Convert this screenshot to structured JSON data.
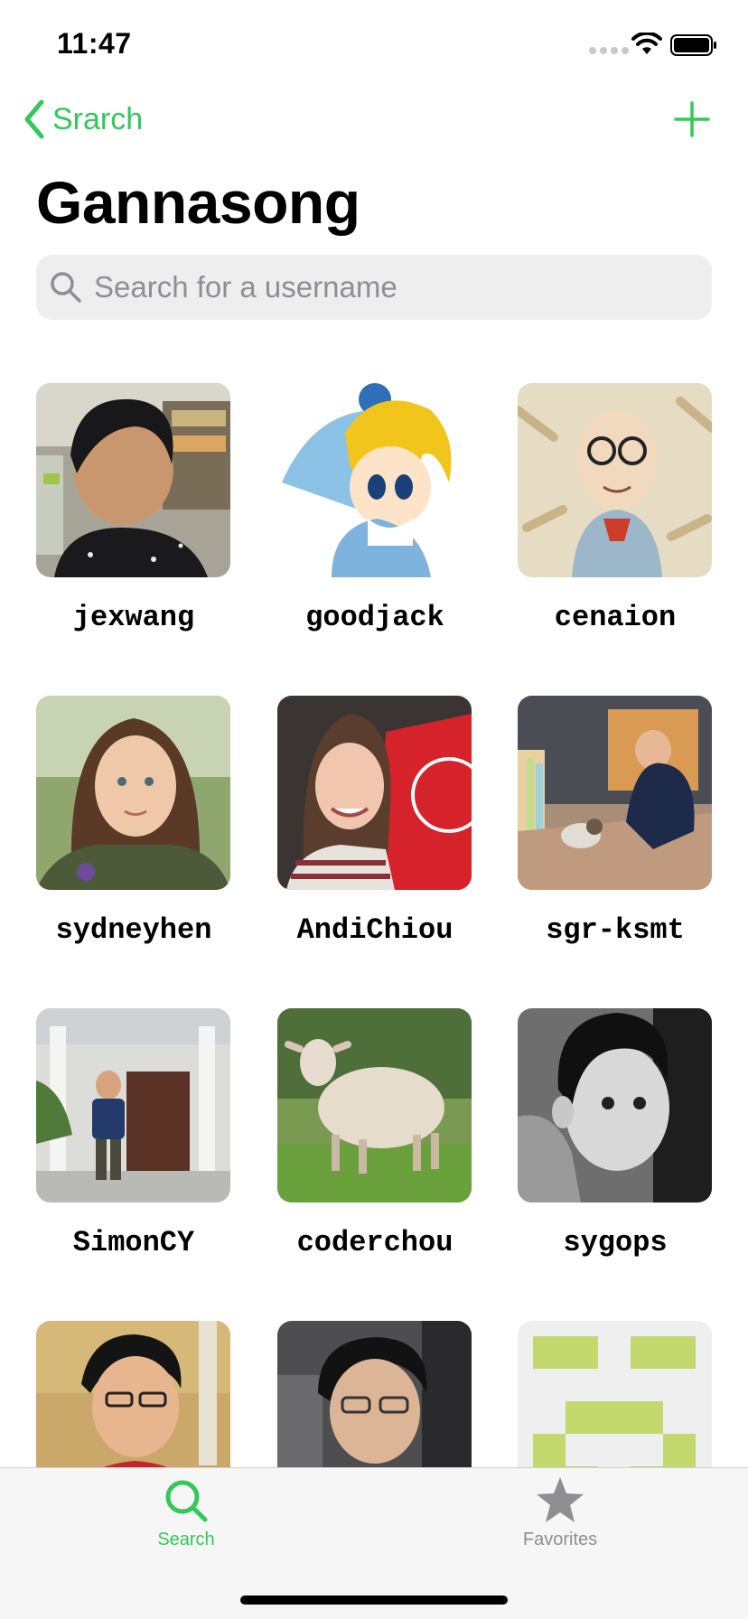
{
  "status": {
    "time": "11:47"
  },
  "nav": {
    "back_label": "Srarch",
    "title": "Gannasong"
  },
  "search": {
    "placeholder": "Search for a username",
    "value": ""
  },
  "followers": [
    {
      "username": "jexwang"
    },
    {
      "username": "goodjack"
    },
    {
      "username": "cenaion"
    },
    {
      "username": "sydneyhen"
    },
    {
      "username": "AndiChiou"
    },
    {
      "username": "sgr-ksmt"
    },
    {
      "username": "SimonCY"
    },
    {
      "username": "coderchou"
    },
    {
      "username": "sygops"
    },
    {
      "username": ""
    },
    {
      "username": ""
    },
    {
      "username": ""
    }
  ],
  "tabs": [
    {
      "label": "Search",
      "icon": "magnifying-glass-icon",
      "active": true
    },
    {
      "label": "Favorites",
      "icon": "star-icon",
      "active": false
    }
  ],
  "colors": {
    "accent": "#34c759",
    "inactive": "#8e8e93",
    "search_bg": "#eeeeef"
  }
}
